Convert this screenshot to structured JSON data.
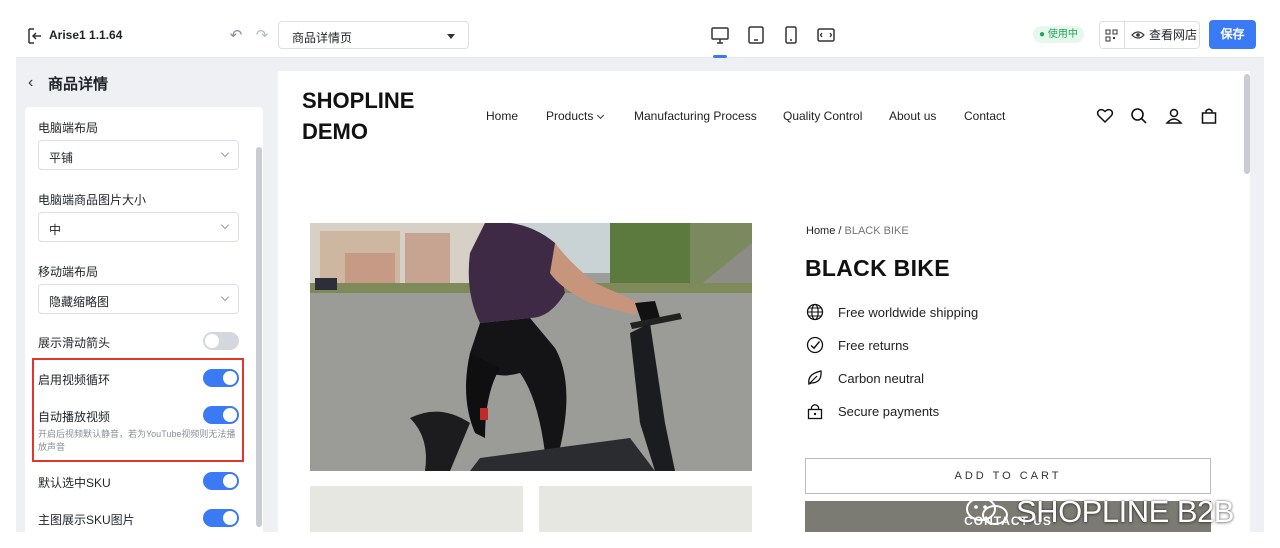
{
  "topbar": {
    "app_name": "Arise1 1.1.64",
    "page_select": "商品详情页",
    "status_badge": "● 使用中",
    "view_store": "查看网店",
    "save": "保存",
    "accent_color": "#3b7af5"
  },
  "left_panel": {
    "title": "商品详情",
    "fields": [
      {
        "label": "电脑端布局",
        "value": "平铺"
      },
      {
        "label": "电脑端商品图片大小",
        "value": "中"
      },
      {
        "label": "移动端布局",
        "value": "隐藏缩略图"
      }
    ],
    "toggles": [
      {
        "label": "展示滑动箭头",
        "on": false
      },
      {
        "label": "启用视频循环",
        "on": true
      },
      {
        "label": "自动播放视频",
        "on": true
      },
      {
        "label": "默认选中SKU",
        "on": true
      },
      {
        "label": "主图展示SKU图片",
        "on": true
      }
    ],
    "autoplay_hint": "开启后视频默认静音，若为YouTube视频则无法播放声音"
  },
  "preview": {
    "logo": "SHOPLINE DEMO",
    "nav": [
      "Home",
      "Products",
      "Manufacturing Process",
      "Quality Control",
      "About us",
      "Contact"
    ],
    "breadcrumb_home": "Home",
    "breadcrumb_sep": " / ",
    "breadcrumb_current": "BLACK BIKE",
    "product_title": "BLACK BIKE",
    "features": [
      {
        "icon": "globe-icon",
        "text": "Free worldwide shipping"
      },
      {
        "icon": "check-circle-icon",
        "text": "Free returns"
      },
      {
        "icon": "leaf-icon",
        "text": "Carbon neutral"
      },
      {
        "icon": "lock-icon",
        "text": "Secure payments"
      }
    ],
    "add_to_cart": "ADD TO CART",
    "contact_us": "CONTACT US"
  },
  "watermark": "SHOPLINE B2B"
}
